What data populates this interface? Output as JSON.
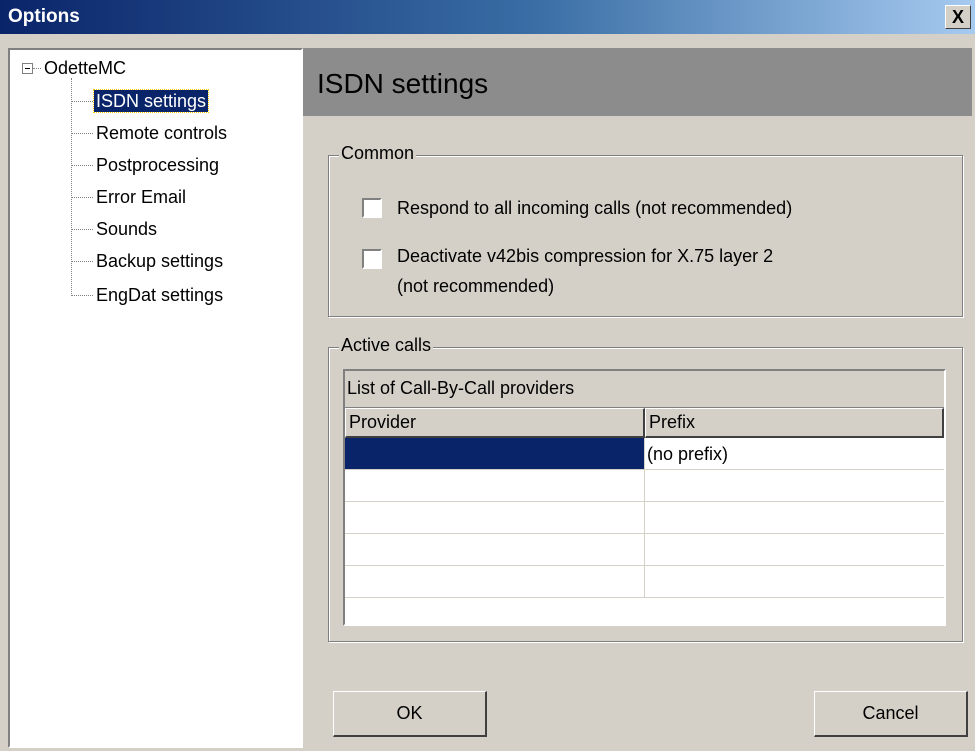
{
  "window": {
    "title": "Options",
    "close_glyph": "X"
  },
  "tree": {
    "root": "OdetteMC",
    "items": [
      {
        "label": "ISDN settings",
        "selected": true
      },
      {
        "label": "Remote controls",
        "selected": false
      },
      {
        "label": "Postprocessing",
        "selected": false
      },
      {
        "label": "Error Email",
        "selected": false
      },
      {
        "label": "Sounds",
        "selected": false
      },
      {
        "label": "Backup settings",
        "selected": false
      },
      {
        "label": "EngDat settings",
        "selected": false
      }
    ]
  },
  "panel": {
    "title": "ISDN settings"
  },
  "common": {
    "legend": "Common",
    "respond_all": {
      "label": "Respond to all incoming calls (not recommended)",
      "checked": false
    },
    "deactivate_v42": {
      "label_line1": "Deactivate v42bis compression for X.75 layer 2",
      "label_line2": "(not recommended)",
      "checked": false
    }
  },
  "active_calls": {
    "legend": "Active calls",
    "caption": "List of Call-By-Call providers",
    "columns": [
      "Provider",
      "Prefix"
    ],
    "rows": [
      {
        "provider": "",
        "prefix": "(no prefix)",
        "selected": true
      },
      {
        "provider": "",
        "prefix": ""
      },
      {
        "provider": "",
        "prefix": ""
      },
      {
        "provider": "",
        "prefix": ""
      },
      {
        "provider": "",
        "prefix": ""
      }
    ]
  },
  "buttons": {
    "ok": "OK",
    "cancel": "Cancel"
  },
  "colors": {
    "selection": "#0a246a",
    "face": "#d4d0c8",
    "header": "#8c8c8c"
  }
}
